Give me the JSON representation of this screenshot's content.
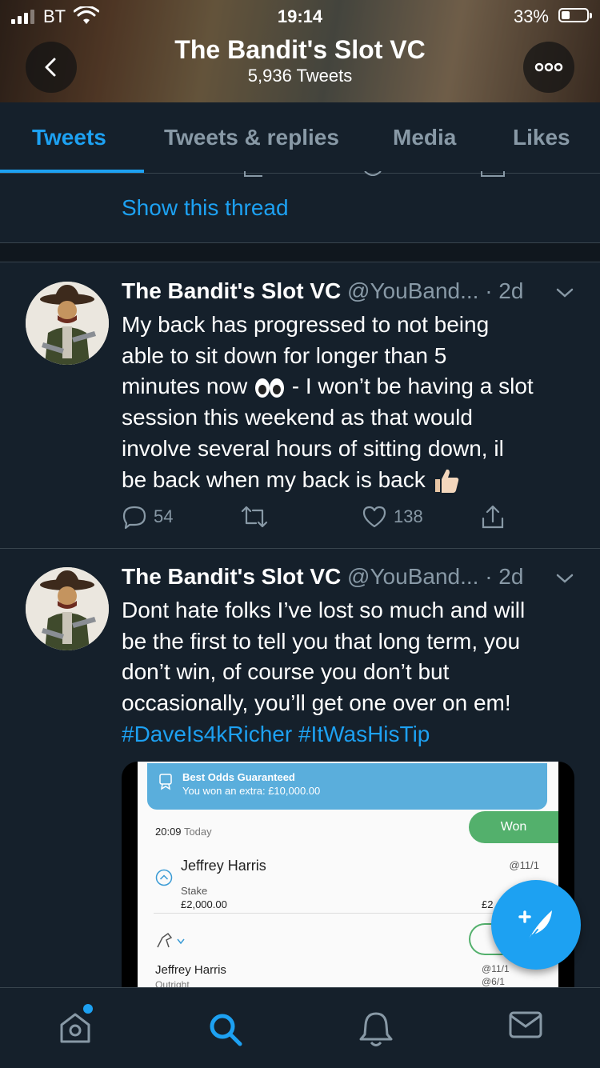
{
  "status_bar": {
    "carrier": "BT",
    "time": "19:14",
    "battery": "33%"
  },
  "header": {
    "title": "The Bandit's Slot VC",
    "subtitle": "5,936 Tweets"
  },
  "tabs": [
    {
      "label": "Tweets",
      "active": true
    },
    {
      "label": "Tweets & replies",
      "active": false
    },
    {
      "label": "Media",
      "active": false
    },
    {
      "label": "Likes",
      "active": false
    }
  ],
  "show_thread": "Show this thread",
  "tweets": [
    {
      "name": "The Bandit's Slot VC",
      "handle": "@YouBand...",
      "time": "· 2d",
      "text_lines": [
        "My back has progressed to not being",
        "able to sit down for longer than 5",
        "minutes now",
        " - I won’t be having a slot",
        "session this weekend as that would",
        "involve several hours of sitting down, il",
        "be back when my back is back"
      ],
      "replies": "54",
      "likes": "138"
    },
    {
      "name": "The Bandit's Slot VC",
      "handle": "@YouBand...",
      "time": "· 2d",
      "text_lines": [
        "Dont hate folks I’ve lost so much and will",
        "be the first to tell you that long term, you",
        "don’t win, of course you don’t but",
        "occasionally, you’ll get one over on em!"
      ],
      "hashtags": [
        "#DaveIs4kRicher",
        "#ItWasHisTip"
      ],
      "media": {
        "banner_title": "Best Odds Guaranteed",
        "banner_sub": "You won an extra: £10,000.00",
        "time": "20:09",
        "day": "Today",
        "status": "Won",
        "selection": "Jeffrey Harris",
        "odds": "@11/1",
        "stake_label": "Stake",
        "stake": "£2,000.00",
        "return_partial": "£2",
        "selection2": "Jeffrey Harris",
        "market2": "Outright",
        "odds2": "@11/1",
        "odds3": "@6/1"
      }
    }
  ],
  "colors": {
    "background": "#15202b",
    "accent": "#1da1f2",
    "muted": "#8899a6",
    "divider": "#38444d",
    "won": "#53b06c"
  }
}
